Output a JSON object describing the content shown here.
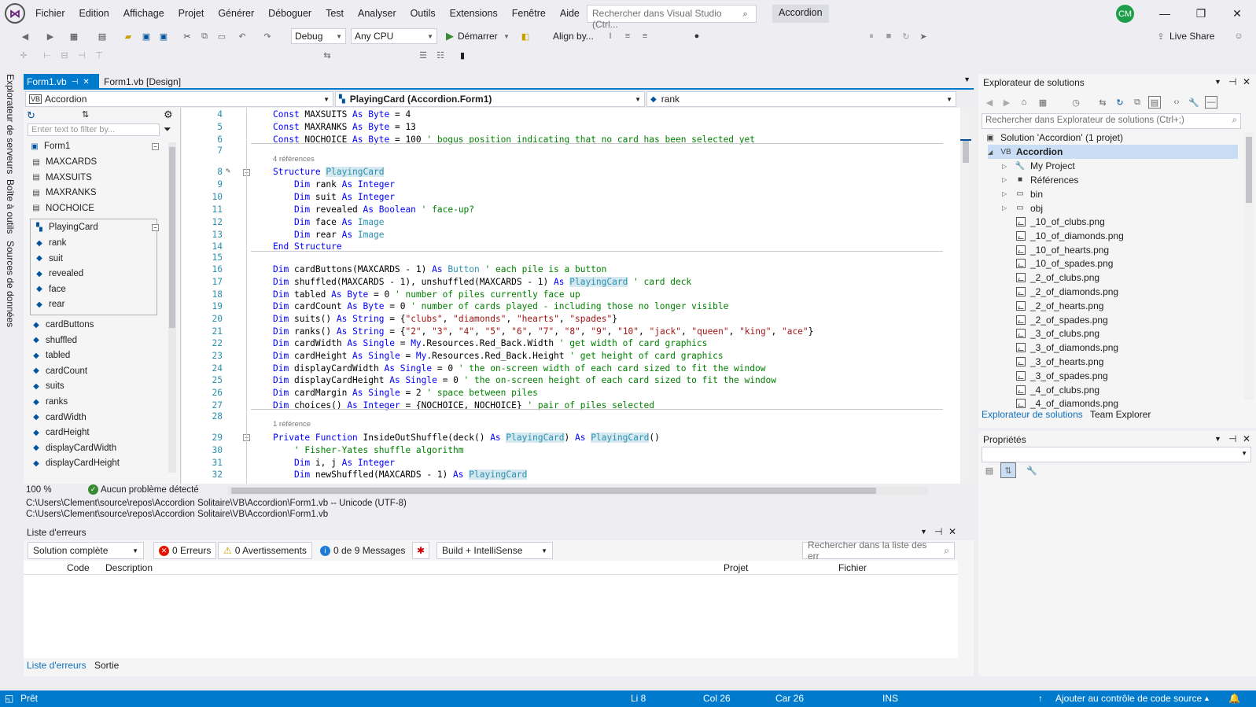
{
  "menu": [
    "Fichier",
    "Edition",
    "Affichage",
    "Projet",
    "Générer",
    "Déboguer",
    "Test",
    "Analyser",
    "Outils",
    "Extensions",
    "Fenêtre",
    "Aide"
  ],
  "search_placeholder": "Rechercher dans Visual Studio (Ctrl...",
  "solution_name": "Accordion",
  "avatar_initials": "CM",
  "toolbar": {
    "config": "Debug",
    "platform": "Any CPU",
    "start": "Démarrer",
    "align": "Align by...",
    "live_share": "Live Share"
  },
  "left_tabs": [
    "Explorateur de serveurs",
    "Boîte à outils",
    "Sources de données"
  ],
  "doc_tabs": [
    {
      "label": "Form1.vb",
      "active": true
    },
    {
      "label": "Form1.vb [Design]",
      "active": false
    }
  ],
  "nav": {
    "project": "Accordion",
    "type": "PlayingCard (Accordion.Form1)",
    "member": "rank"
  },
  "class_view": {
    "filter_placeholder": "Enter text to filter by...",
    "root": "Form1",
    "consts": [
      "MAXCARDS",
      "MAXSUITS",
      "MAXRANKS",
      "NOCHOICE"
    ],
    "struct": "PlayingCard",
    "struct_members": [
      "rank",
      "suit",
      "revealed",
      "face",
      "rear"
    ],
    "fields": [
      "cardButtons",
      "shuffled",
      "tabled",
      "cardCount",
      "suits",
      "ranks",
      "cardWidth",
      "cardHeight",
      "displayCardWidth",
      "displayCardHeight"
    ]
  },
  "editor": {
    "line_numbers": [
      "4",
      "5",
      "6",
      "7",
      "8",
      "9",
      "10",
      "11",
      "12",
      "13",
      "14",
      "15",
      "16",
      "17",
      "18",
      "19",
      "20",
      "21",
      "22",
      "23",
      "24",
      "25",
      "26",
      "27",
      "28",
      "29",
      "30",
      "31",
      "32"
    ],
    "refs1": "4 références",
    "refs2": "1 référence"
  },
  "editor_status": {
    "zoom": "100 %",
    "issues": "Aucun problème détecté"
  },
  "path_lines": [
    "C:\\Users\\Clement\\source\\repos\\Accordion Solitaire\\VB\\Accordion\\Form1.vb -- Unicode (UTF-8)",
    "C:\\Users\\Clement\\source\\repos\\Accordion Solitaire\\VB\\Accordion\\Form1.vb"
  ],
  "error_list": {
    "title": "Liste d'erreurs",
    "scope": "Solution complète",
    "errors": "0 Erreurs",
    "warnings": "0 Avertissements",
    "messages": "0 de 9 Messages",
    "build": "Build + IntelliSense",
    "search": "Rechercher dans la liste des err",
    "columns": {
      "code": "Code",
      "description": "Description",
      "project": "Projet",
      "file": "Fichier"
    }
  },
  "bottom_tabs": [
    "Liste d'erreurs",
    "Sortie"
  ],
  "solution_explorer": {
    "title": "Explorateur de solutions",
    "search": "Rechercher dans Explorateur de solutions (Ctrl+;)",
    "solution": "Solution 'Accordion' (1 projet)",
    "project": "Accordion",
    "folders": [
      "My Project",
      "Références",
      "bin",
      "obj"
    ],
    "files": [
      "_10_of_clubs.png",
      "_10_of_diamonds.png",
      "_10_of_hearts.png",
      "_10_of_spades.png",
      "_2_of_clubs.png",
      "_2_of_diamonds.png",
      "_2_of_hearts.png",
      "_2_of_spades.png",
      "_3_of_clubs.png",
      "_3_of_diamonds.png",
      "_3_of_hearts.png",
      "_3_of_spades.png",
      "_4_of_clubs.png",
      "_4_of_diamonds.png"
    ],
    "tabs": [
      "Explorateur de solutions",
      "Team Explorer"
    ]
  },
  "properties": {
    "title": "Propriétés"
  },
  "status": {
    "ready": "Prêt",
    "line": "Li 8",
    "col": "Col 26",
    "car": "Car 26",
    "mode": "INS",
    "source_control": "Ajouter au contrôle de code source"
  },
  "colors": {
    "accent": "#007acc",
    "keyword": "#0000ff",
    "type": "#2b91af",
    "comment": "#008000",
    "string": "#a31515"
  }
}
